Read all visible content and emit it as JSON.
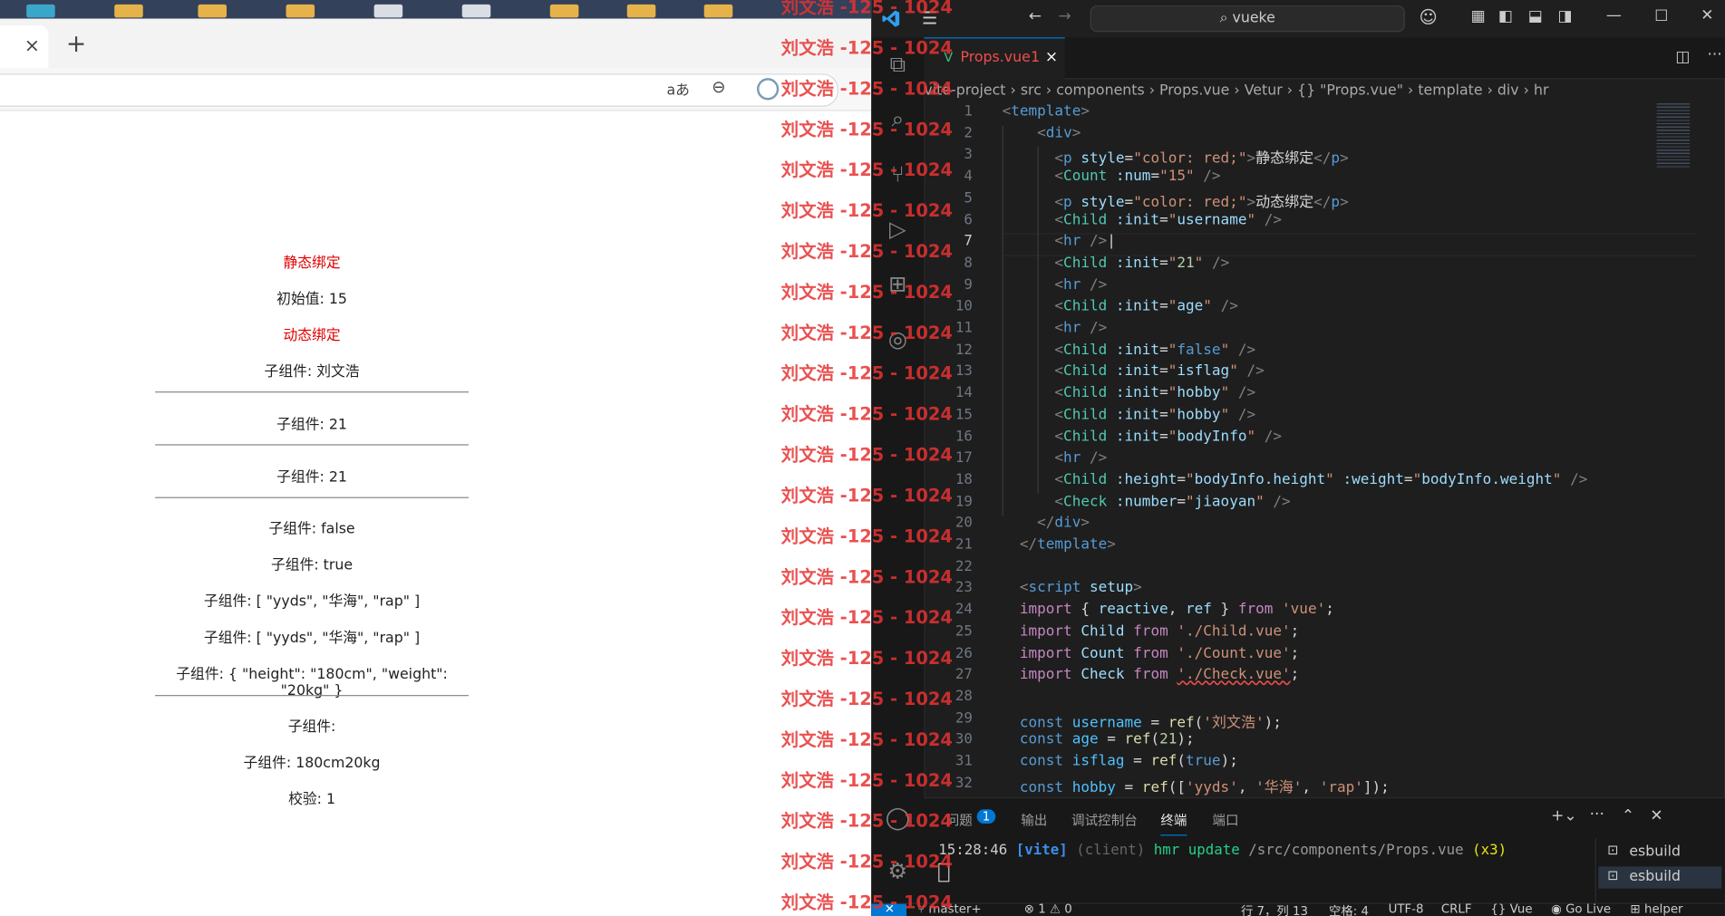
{
  "watermark": "刘文浩 -125 - 1024",
  "browser": {
    "tab_close": "×",
    "tab_new": "+",
    "read_aloud_icon": "aあ",
    "zoom_icon": "⊖",
    "lines": [
      {
        "text": "静态绑定",
        "red": true
      },
      {
        "text": "初始值: 15"
      },
      {
        "text": "动态绑定",
        "red": true
      },
      {
        "text": "子组件: 刘文浩"
      },
      {
        "text": "子组件: 21"
      },
      {
        "text": "子组件: 21"
      },
      {
        "text": "子组件: false"
      },
      {
        "text": "子组件: true"
      },
      {
        "text": "子组件: [ \"yyds\", \"华海\", \"rap\" ]"
      },
      {
        "text": "子组件: [ \"yyds\", \"华海\", \"rap\" ]"
      },
      {
        "text": "子组件: { \"height\": \"180cm\", \"weight\": \"20kg\" }"
      },
      {
        "text": "子组件:"
      },
      {
        "text": "子组件: 180cm20kg"
      },
      {
        "text": "校验: 1"
      }
    ]
  },
  "vscode": {
    "search": "vueke",
    "tab_label": "Props.vue",
    "tab_badge": "1",
    "breadcrumb": [
      "vite-project",
      "src",
      "components",
      "Props.vue",
      "Vetur",
      "{} \"Props.vue\"",
      "template",
      "div",
      "hr"
    ],
    "panel_tabs": [
      "问题",
      "输出",
      "调试控制台",
      "终端",
      "端口"
    ],
    "problems_count": "1",
    "terminal_time": "15:28:46",
    "terminal_tag": "[vite]",
    "terminal_client": "(client)",
    "terminal_msg": "hmr update",
    "terminal_path": "/src/components/Props.vue",
    "terminal_count": "(x3)",
    "terminals": [
      "esbuild",
      "esbuild"
    ],
    "status": {
      "branch": "master+",
      "errors": "⊗ 1 ⚠ 0",
      "position": "行 7，列 13",
      "spaces": "空格: 4",
      "encoding": "UTF-8",
      "eol": "CRLF",
      "lang": "{} Vue",
      "golive": "Go Live",
      "helper": "helper"
    },
    "line_numbers": [
      "1",
      "2",
      "3",
      "4",
      "5",
      "6",
      "7",
      "8",
      "9",
      "10",
      "11",
      "12",
      "13",
      "14",
      "15",
      "16",
      "17",
      "18",
      "19",
      "20",
      "21",
      "22",
      "23",
      "24",
      "25",
      "26",
      "27",
      "28",
      "29",
      "30",
      "31",
      "32"
    ]
  }
}
